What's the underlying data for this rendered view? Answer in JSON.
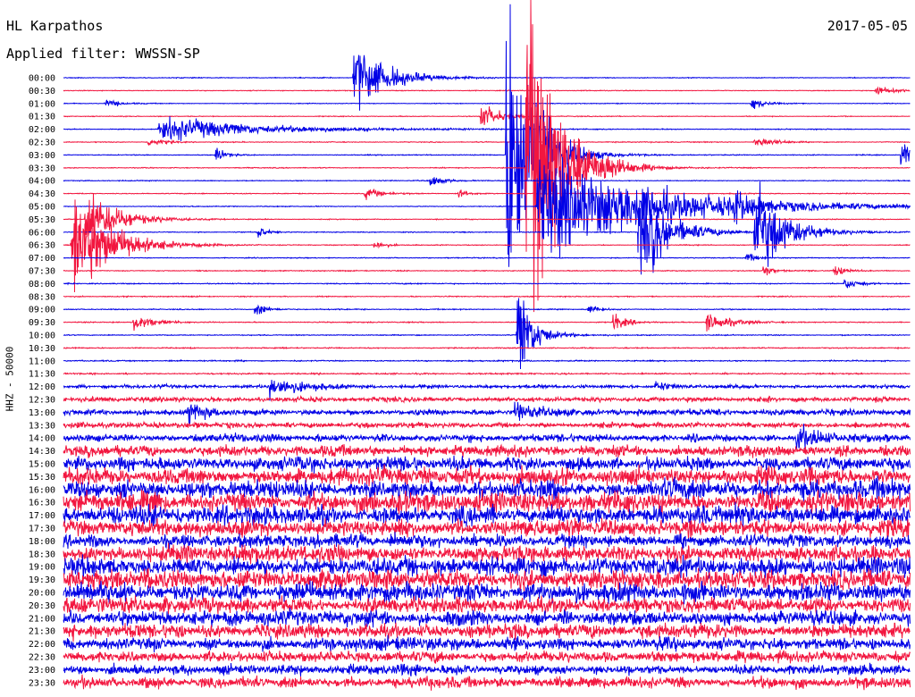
{
  "header": {
    "station": "HL Karpathos",
    "filter": "Applied filter: WWSSN-SP",
    "date": "2017-05-05"
  },
  "chart_data": {
    "type": "helicorder",
    "ylabel": "HHZ - 50000",
    "row_labels": [
      "00:00",
      "00:30",
      "01:00",
      "01:30",
      "02:00",
      "02:30",
      "03:00",
      "03:30",
      "04:00",
      "04:30",
      "05:00",
      "05:30",
      "06:00",
      "06:30",
      "07:00",
      "07:30",
      "08:00",
      "08:30",
      "09:00",
      "09:30",
      "10:00",
      "10:30",
      "11:00",
      "11:30",
      "12:00",
      "12:30",
      "13:00",
      "13:30",
      "14:00",
      "14:30",
      "15:00",
      "15:30",
      "16:00",
      "16:30",
      "17:00",
      "17:30",
      "18:00",
      "18:30",
      "19:00",
      "19:30",
      "20:00",
      "20:30",
      "21:00",
      "21:30",
      "22:00",
      "22:30",
      "23:00",
      "23:30"
    ],
    "row_minutes": 30,
    "series_colors": [
      "#0000e6",
      "#f2163f"
    ],
    "noise_level": [
      0.3,
      0.3,
      0.3,
      0.3,
      0.35,
      0.35,
      0.35,
      0.35,
      0.35,
      0.35,
      0.35,
      0.35,
      0.35,
      0.35,
      0.35,
      0.4,
      0.4,
      0.4,
      0.4,
      0.4,
      0.4,
      0.45,
      0.5,
      0.6,
      1.5,
      2.0,
      2.5,
      2.2,
      3.0,
      4.5,
      5.5,
      6.5,
      7.5,
      8.0,
      7.5,
      6.5,
      5.5,
      6.5,
      7.5,
      8.0,
      7.5,
      6.5,
      6.0,
      5.5,
      5.0,
      4.5,
      4.0,
      4.5
    ],
    "events": [
      {
        "row": 0,
        "minute": 10.3,
        "amp": 38,
        "dur": 1.0
      },
      {
        "row": 1,
        "minute": 28.8,
        "amp": 5,
        "dur": 0.5
      },
      {
        "row": 2,
        "minute": 1.5,
        "amp": 4,
        "dur": 0.4
      },
      {
        "row": 2,
        "minute": 24.4,
        "amp": 6,
        "dur": 0.4
      },
      {
        "row": 3,
        "minute": 14.8,
        "amp": 12,
        "dur": 0.6
      },
      {
        "row": 4,
        "minute": 3.4,
        "amp": 12,
        "dur": 3.0
      },
      {
        "row": 5,
        "minute": 3.0,
        "amp": 5,
        "dur": 0.4
      },
      {
        "row": 5,
        "minute": 24.5,
        "amp": 5,
        "dur": 0.6
      },
      {
        "row": 6,
        "minute": 5.4,
        "amp": 8,
        "dur": 0.3
      },
      {
        "row": 6,
        "minute": 15.7,
        "amp": 200,
        "dur": 0.8
      },
      {
        "row": 6,
        "minute": 29.7,
        "amp": 14,
        "dur": 0.4
      },
      {
        "row": 7,
        "minute": 16.4,
        "amp": 180,
        "dur": 1.0
      },
      {
        "row": 7,
        "minute": 19.0,
        "amp": 5,
        "dur": 0.3
      },
      {
        "row": 8,
        "minute": 13.0,
        "amp": 6,
        "dur": 0.4
      },
      {
        "row": 9,
        "minute": 10.7,
        "amp": 6,
        "dur": 0.5
      },
      {
        "row": 9,
        "minute": 14.0,
        "amp": 4,
        "dur": 0.3
      },
      {
        "row": 10,
        "minute": 16.8,
        "amp": 45,
        "dur": 4.0
      },
      {
        "row": 10,
        "minute": 23.8,
        "amp": 14,
        "dur": 0.3
      },
      {
        "row": 11,
        "minute": 0.8,
        "amp": 30,
        "dur": 1.0
      },
      {
        "row": 12,
        "minute": 20.4,
        "amp": 50,
        "dur": 1.0
      },
      {
        "row": 12,
        "minute": 24.5,
        "amp": 45,
        "dur": 1.0
      },
      {
        "row": 12,
        "minute": 6.9,
        "amp": 6,
        "dur": 0.3
      },
      {
        "row": 13,
        "minute": 0.3,
        "amp": 55,
        "dur": 1.2
      },
      {
        "row": 13,
        "minute": 11.0,
        "amp": 5,
        "dur": 0.3
      },
      {
        "row": 14,
        "minute": 24.2,
        "amp": 5,
        "dur": 0.3
      },
      {
        "row": 15,
        "minute": 24.8,
        "amp": 6,
        "dur": 0.3
      },
      {
        "row": 15,
        "minute": 27.3,
        "amp": 5,
        "dur": 0.4
      },
      {
        "row": 16,
        "minute": 27.7,
        "amp": 6,
        "dur": 0.4
      },
      {
        "row": 18,
        "minute": 6.8,
        "amp": 8,
        "dur": 0.3
      },
      {
        "row": 18,
        "minute": 18.6,
        "amp": 5,
        "dur": 0.3
      },
      {
        "row": 19,
        "minute": 2.5,
        "amp": 10,
        "dur": 0.5
      },
      {
        "row": 19,
        "minute": 19.5,
        "amp": 10,
        "dur": 0.4
      },
      {
        "row": 19,
        "minute": 22.8,
        "amp": 9,
        "dur": 0.8
      },
      {
        "row": 20,
        "minute": 16.1,
        "amp": 50,
        "dur": 0.5
      },
      {
        "row": 24,
        "minute": 7.3,
        "amp": 10,
        "dur": 1.0
      },
      {
        "row": 24,
        "minute": 21.0,
        "amp": 5,
        "dur": 0.4
      },
      {
        "row": 26,
        "minute": 4.4,
        "amp": 8,
        "dur": 0.8
      },
      {
        "row": 26,
        "minute": 16.0,
        "amp": 10,
        "dur": 0.6
      },
      {
        "row": 28,
        "minute": 26.0,
        "amp": 12,
        "dur": 0.6
      }
    ]
  }
}
